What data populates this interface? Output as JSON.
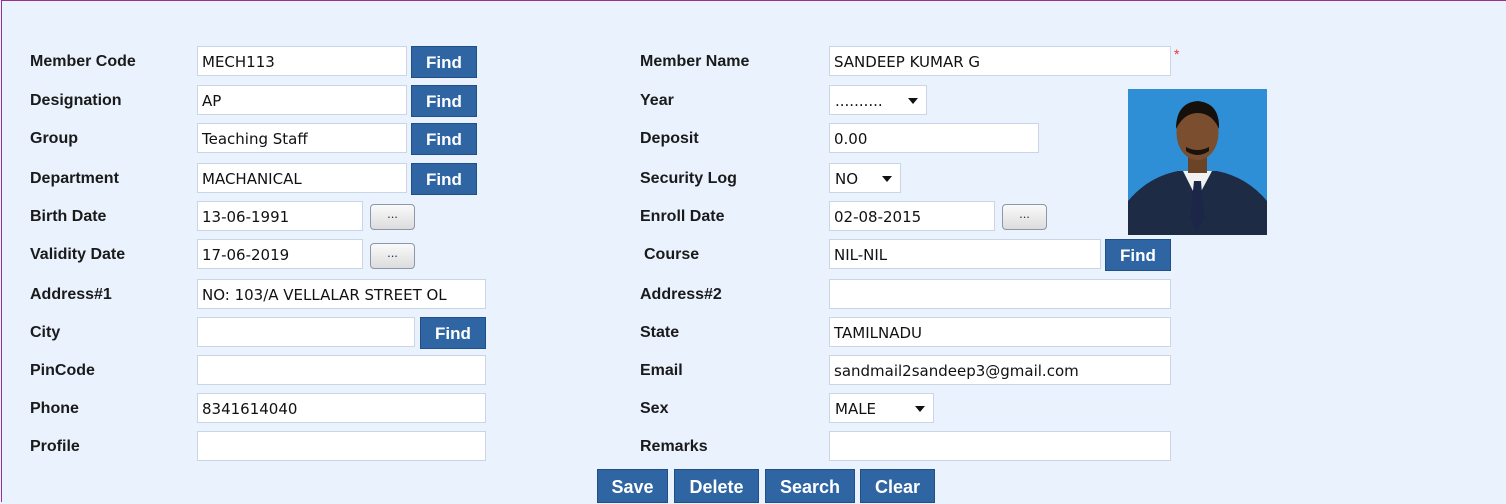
{
  "find_label": "Find",
  "dots_label": "...",
  "fields": {
    "member_code": {
      "label": "Member Code",
      "value": "MECH113"
    },
    "designation": {
      "label": "Designation",
      "value": "AP"
    },
    "group": {
      "label": "Group",
      "value": "Teaching Staff"
    },
    "department": {
      "label": "Department",
      "value": "MACHANICAL"
    },
    "birth_date": {
      "label": "Birth Date",
      "value": "13-06-1991"
    },
    "validity_date": {
      "label": "Validity Date",
      "value": "17-06-2019"
    },
    "address1": {
      "label": "Address#1",
      "value": "NO: 103/A VELLALAR STREET OL"
    },
    "city": {
      "label": "City",
      "value": ""
    },
    "pincode": {
      "label": "PinCode",
      "value": ""
    },
    "phone": {
      "label": "Phone",
      "value": "8341614040"
    },
    "profile": {
      "label": "Profile",
      "value": ""
    },
    "member_name": {
      "label": "Member Name",
      "value": "SANDEEP KUMAR G"
    },
    "year": {
      "label": "Year",
      "value": ".........."
    },
    "deposit": {
      "label": "Deposit",
      "value": "0.00"
    },
    "security_log": {
      "label": "Security Log",
      "value": "NO"
    },
    "enroll_date": {
      "label": "Enroll Date",
      "value": "02-08-2015"
    },
    "course": {
      "label": "Course",
      "value": "NIL-NIL"
    },
    "address2": {
      "label": "Address#2",
      "value": ""
    },
    "state": {
      "label": "State",
      "value": "TAMILNADU"
    },
    "email": {
      "label": "Email",
      "value": "sandmail2sandeep3@gmail.com"
    },
    "sex": {
      "label": "Sex",
      "value": "MALE"
    },
    "remarks": {
      "label": "Remarks",
      "value": ""
    }
  },
  "required_marker": "*",
  "buttons": {
    "save": "Save",
    "delete": "Delete",
    "search": "Search",
    "clear": "Clear"
  }
}
